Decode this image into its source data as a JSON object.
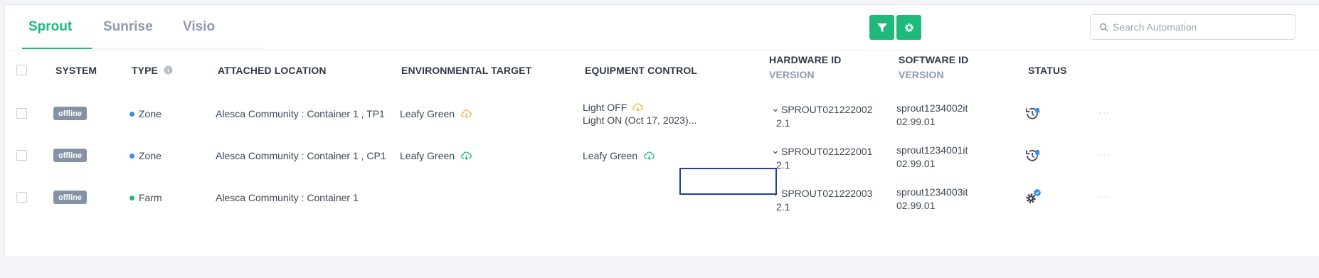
{
  "tabs": [
    {
      "label": "Sprout"
    },
    {
      "label": "Sunrise"
    },
    {
      "label": "Visio"
    }
  ],
  "search": {
    "placeholder": "Search Automation"
  },
  "colors": {
    "accent": "#1fb97c",
    "badge": "#8492a5",
    "zone_dot": "#3b8eea",
    "farm_dot": "#1fb97c",
    "cloud_orange": "#f0b43a",
    "cloud_green": "#1fb97c",
    "notify_blue": "#2d8cf0",
    "highlight": "#1e3fa8"
  },
  "columns": {
    "system": "SYSTEM",
    "type": "TYPE",
    "location": "ATTACHED LOCATION",
    "env_target": "ENVIRONMENTAL TARGET",
    "equipment": "EQUIPMENT CONTROL",
    "hardware": "HARDWARE ID",
    "hardware_sub": "VERSION",
    "software": "SOFTWARE ID",
    "software_sub": "VERSION",
    "status": "STATUS"
  },
  "rows": [
    {
      "system": "offline",
      "type": "Zone",
      "location": "Alesca Community : Container 1 , TP1",
      "env_target": "Leafy Green",
      "equipment_line1": "Light OFF",
      "equipment_line2": "Light ON (Oct 17, 2023)...",
      "hardware_id": "SPROUT021222002",
      "hardware_version": "2.1",
      "software_id": "sprout1234002it",
      "software_version": "02.99.01",
      "status_icon": "history-bell-icon",
      "more": "···"
    },
    {
      "system": "offline",
      "type": "Zone",
      "location": "Alesca Community : Container 1 , CP1",
      "env_target": "Leafy Green",
      "equipment_line1": "Leafy Green",
      "hardware_id": "SPROUT021222001",
      "hardware_version": "2.1",
      "software_id": "sprout1234001it",
      "software_version": "02.99.01",
      "status_icon": "history-bell-icon",
      "more": "···"
    },
    {
      "system": "offline",
      "type": "Farm",
      "location": "Alesca Community : Container 1",
      "hardware_id": "SPROUT021222003",
      "hardware_version": "2.1",
      "software_id": "sprout1234003it",
      "software_version": "02.99.01",
      "status_icon": "gear-check-icon",
      "more": "···"
    }
  ]
}
